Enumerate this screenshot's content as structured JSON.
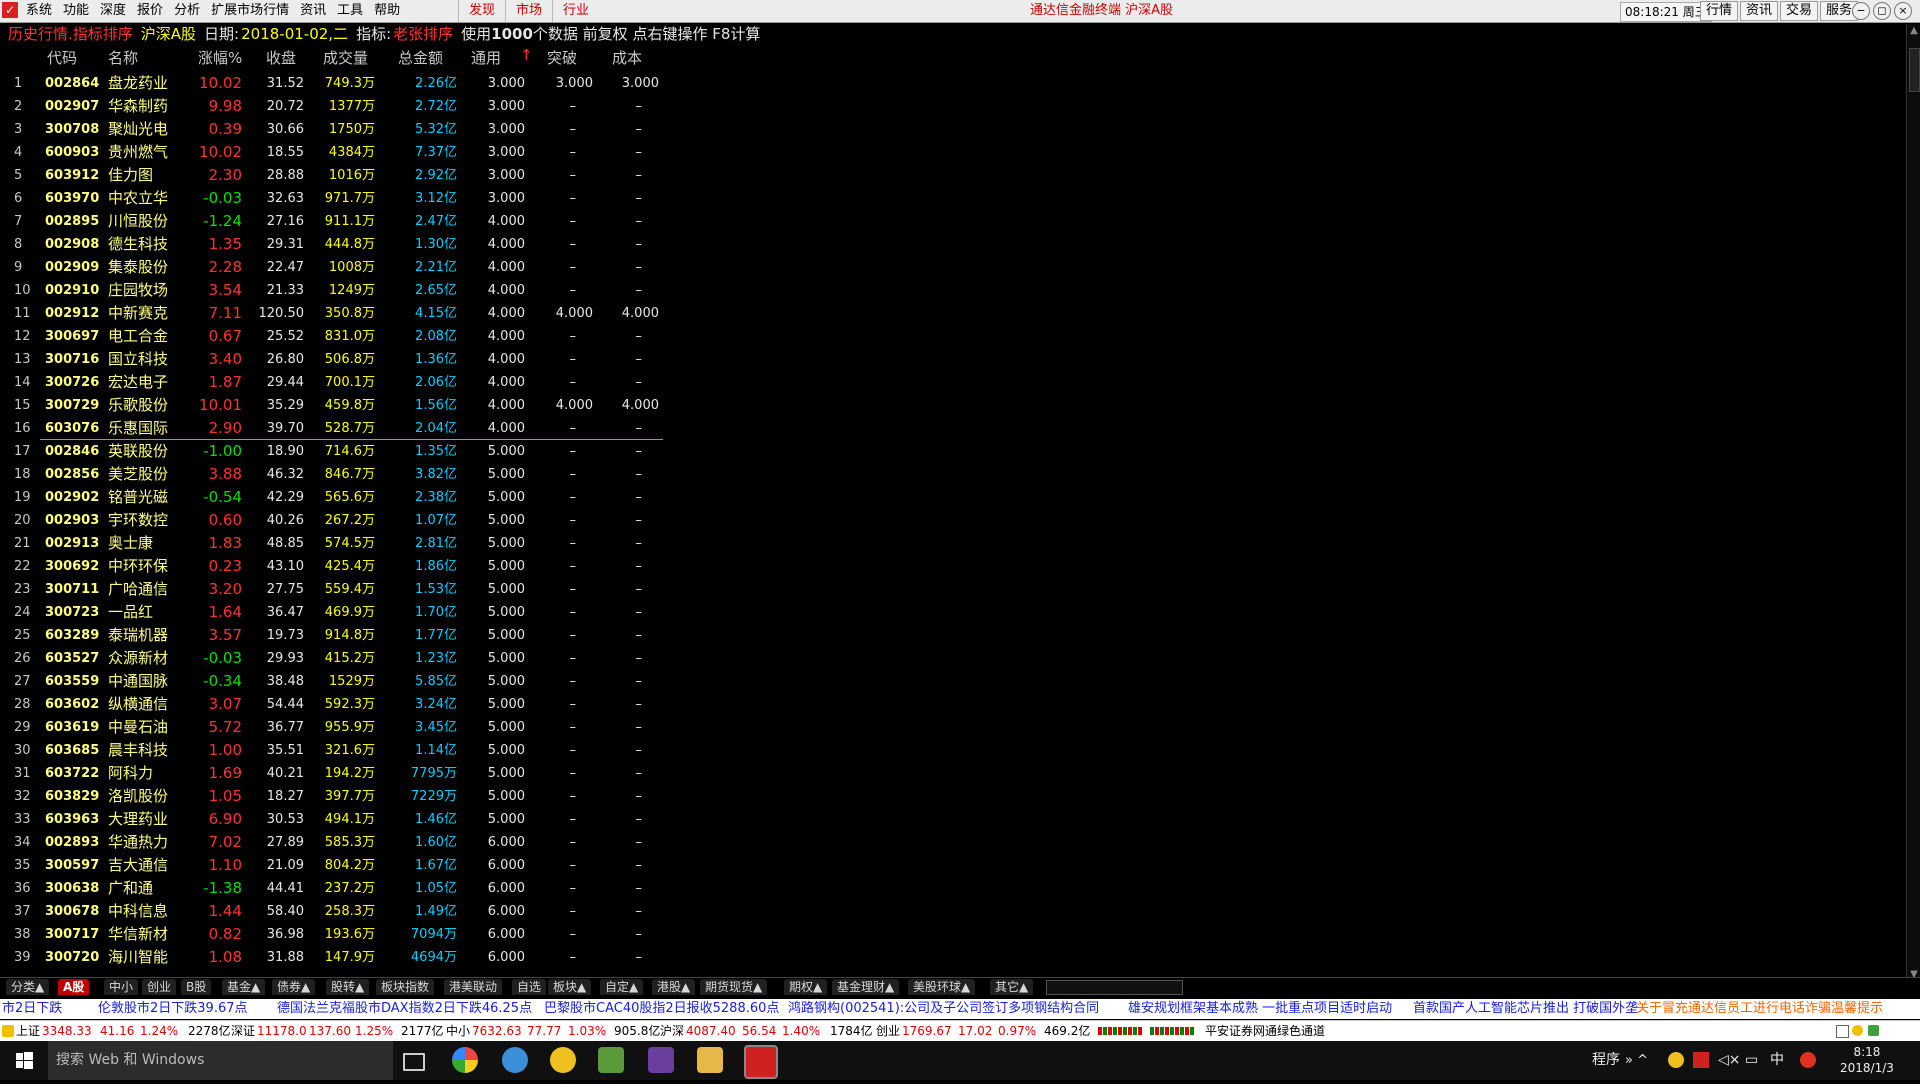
{
  "menubar": {
    "items": [
      "系统",
      "功能",
      "深度",
      "报价",
      "分析",
      "扩展市场行情",
      "资讯",
      "工具",
      "帮助"
    ],
    "highlights": [
      "发现",
      "市场",
      "行业"
    ],
    "app_title": "通达信金融终端  沪深A股",
    "clock": "08:18:21 周三",
    "right_buttons": [
      "行情",
      "资讯",
      "交易",
      "服务"
    ],
    "window_buttons": [
      "−",
      "◻",
      "×"
    ]
  },
  "infobar": {
    "mode": "历史行情.指标排序",
    "market": "沪深A股",
    "date_label": "日期:",
    "date": "2018-01-02,二",
    "indicator_label": "指标:",
    "indicator": "老张排序",
    "note_prefix": "使用",
    "note_count": "1000",
    "note_rest": "个数据 前复权 点右键操作 F8计算"
  },
  "table": {
    "headers": [
      "代码",
      "名称",
      "涨幅%",
      "收盘",
      "成交量",
      "总金额",
      "通用",
      "突破",
      "成本"
    ],
    "sort_indicator": "↑",
    "rows": [
      {
        "n": "1",
        "code": "002864",
        "name": "盘龙药业",
        "chg": "10.02",
        "dir": "up",
        "close": "31.52",
        "vol": "749.3万",
        "amt": "2.26亿",
        "gen": "3.000",
        "brk": "3.000",
        "cost": "3.000"
      },
      {
        "n": "2",
        "code": "002907",
        "name": "华森制药",
        "chg": "9.98",
        "dir": "up",
        "close": "20.72",
        "vol": "1377万",
        "amt": "2.72亿",
        "gen": "3.000",
        "brk": "–",
        "cost": "–"
      },
      {
        "n": "3",
        "code": "300708",
        "name": "聚灿光电",
        "chg": "0.39",
        "dir": "up",
        "close": "30.66",
        "vol": "1750万",
        "amt": "5.32亿",
        "gen": "3.000",
        "brk": "–",
        "cost": "–"
      },
      {
        "n": "4",
        "code": "600903",
        "name": "贵州燃气",
        "chg": "10.02",
        "dir": "up",
        "close": "18.55",
        "vol": "4384万",
        "amt": "7.37亿",
        "gen": "3.000",
        "brk": "–",
        "cost": "–"
      },
      {
        "n": "5",
        "code": "603912",
        "name": "佳力图",
        "chg": "2.30",
        "dir": "up",
        "close": "28.88",
        "vol": "1016万",
        "amt": "2.92亿",
        "gen": "3.000",
        "brk": "–",
        "cost": "–"
      },
      {
        "n": "6",
        "code": "603970",
        "name": "中农立华",
        "chg": "-0.03",
        "dir": "dn",
        "close": "32.63",
        "vol": "971.7万",
        "amt": "3.12亿",
        "gen": "3.000",
        "brk": "–",
        "cost": "–"
      },
      {
        "n": "7",
        "code": "002895",
        "name": "川恒股份",
        "chg": "-1.24",
        "dir": "dn",
        "close": "27.16",
        "vol": "911.1万",
        "amt": "2.47亿",
        "gen": "4.000",
        "brk": "–",
        "cost": "–"
      },
      {
        "n": "8",
        "code": "002908",
        "name": "德生科技",
        "chg": "1.35",
        "dir": "up",
        "close": "29.31",
        "vol": "444.8万",
        "amt": "1.30亿",
        "gen": "4.000",
        "brk": "–",
        "cost": "–"
      },
      {
        "n": "9",
        "code": "002909",
        "name": "集泰股份",
        "chg": "2.28",
        "dir": "up",
        "close": "22.47",
        "vol": "1008万",
        "amt": "2.21亿",
        "gen": "4.000",
        "brk": "–",
        "cost": "–"
      },
      {
        "n": "10",
        "code": "002910",
        "name": "庄园牧场",
        "chg": "3.54",
        "dir": "up",
        "close": "21.33",
        "vol": "1249万",
        "amt": "2.65亿",
        "gen": "4.000",
        "brk": "–",
        "cost": "–"
      },
      {
        "n": "11",
        "code": "002912",
        "name": "中新赛克",
        "chg": "7.11",
        "dir": "up",
        "close": "120.50",
        "vol": "350.8万",
        "amt": "4.15亿",
        "gen": "4.000",
        "brk": "4.000",
        "cost": "4.000"
      },
      {
        "n": "12",
        "code": "300697",
        "name": "电工合金",
        "chg": "0.67",
        "dir": "up",
        "close": "25.52",
        "vol": "831.0万",
        "amt": "2.08亿",
        "gen": "4.000",
        "brk": "–",
        "cost": "–"
      },
      {
        "n": "13",
        "code": "300716",
        "name": "国立科技",
        "chg": "3.40",
        "dir": "up",
        "close": "26.80",
        "vol": "506.8万",
        "amt": "1.36亿",
        "gen": "4.000",
        "brk": "–",
        "cost": "–"
      },
      {
        "n": "14",
        "code": "300726",
        "name": "宏达电子",
        "chg": "1.87",
        "dir": "up",
        "close": "29.44",
        "vol": "700.1万",
        "amt": "2.06亿",
        "gen": "4.000",
        "brk": "–",
        "cost": "–"
      },
      {
        "n": "15",
        "code": "300729",
        "name": "乐歌股份",
        "chg": "10.01",
        "dir": "up",
        "close": "35.29",
        "vol": "459.8万",
        "amt": "1.56亿",
        "gen": "4.000",
        "brk": "4.000",
        "cost": "4.000"
      },
      {
        "n": "16",
        "code": "603076",
        "name": "乐惠国际",
        "chg": "2.90",
        "dir": "up",
        "close": "39.70",
        "vol": "528.7万",
        "amt": "2.04亿",
        "gen": "4.000",
        "brk": "–",
        "cost": "–"
      },
      {
        "n": "17",
        "code": "002846",
        "name": "英联股份",
        "chg": "-1.00",
        "dir": "dn",
        "close": "18.90",
        "vol": "714.6万",
        "amt": "1.35亿",
        "gen": "5.000",
        "brk": "–",
        "cost": "–"
      },
      {
        "n": "18",
        "code": "002856",
        "name": "美芝股份",
        "chg": "3.88",
        "dir": "up",
        "close": "46.32",
        "vol": "846.7万",
        "amt": "3.82亿",
        "gen": "5.000",
        "brk": "–",
        "cost": "–"
      },
      {
        "n": "19",
        "code": "002902",
        "name": "铭普光磁",
        "chg": "-0.54",
        "dir": "dn",
        "close": "42.29",
        "vol": "565.6万",
        "amt": "2.38亿",
        "gen": "5.000",
        "brk": "–",
        "cost": "–"
      },
      {
        "n": "20",
        "code": "002903",
        "name": "宇环数控",
        "chg": "0.60",
        "dir": "up",
        "close": "40.26",
        "vol": "267.2万",
        "amt": "1.07亿",
        "gen": "5.000",
        "brk": "–",
        "cost": "–"
      },
      {
        "n": "21",
        "code": "002913",
        "name": "奥士康",
        "chg": "1.83",
        "dir": "up",
        "close": "48.85",
        "vol": "574.5万",
        "amt": "2.81亿",
        "gen": "5.000",
        "brk": "–",
        "cost": "–"
      },
      {
        "n": "22",
        "code": "300692",
        "name": "中环环保",
        "chg": "0.23",
        "dir": "up",
        "close": "43.10",
        "vol": "425.4万",
        "amt": "1.86亿",
        "gen": "5.000",
        "brk": "–",
        "cost": "–"
      },
      {
        "n": "23",
        "code": "300711",
        "name": "广哈通信",
        "chg": "3.20",
        "dir": "up",
        "close": "27.75",
        "vol": "559.4万",
        "amt": "1.53亿",
        "gen": "5.000",
        "brk": "–",
        "cost": "–"
      },
      {
        "n": "24",
        "code": "300723",
        "name": "一品红",
        "chg": "1.64",
        "dir": "up",
        "close": "36.47",
        "vol": "469.9万",
        "amt": "1.70亿",
        "gen": "5.000",
        "brk": "–",
        "cost": "–"
      },
      {
        "n": "25",
        "code": "603289",
        "name": "泰瑞机器",
        "chg": "3.57",
        "dir": "up",
        "close": "19.73",
        "vol": "914.8万",
        "amt": "1.77亿",
        "gen": "5.000",
        "brk": "–",
        "cost": "–"
      },
      {
        "n": "26",
        "code": "603527",
        "name": "众源新材",
        "chg": "-0.03",
        "dir": "dn",
        "close": "29.93",
        "vol": "415.2万",
        "amt": "1.23亿",
        "gen": "5.000",
        "brk": "–",
        "cost": "–"
      },
      {
        "n": "27",
        "code": "603559",
        "name": "中通国脉",
        "chg": "-0.34",
        "dir": "dn",
        "close": "38.48",
        "vol": "1529万",
        "amt": "5.85亿",
        "gen": "5.000",
        "brk": "–",
        "cost": "–"
      },
      {
        "n": "28",
        "code": "603602",
        "name": "纵横通信",
        "chg": "3.07",
        "dir": "up",
        "close": "54.44",
        "vol": "592.3万",
        "amt": "3.24亿",
        "gen": "5.000",
        "brk": "–",
        "cost": "–"
      },
      {
        "n": "29",
        "code": "603619",
        "name": "中曼石油",
        "chg": "5.72",
        "dir": "up",
        "close": "36.77",
        "vol": "955.9万",
        "amt": "3.45亿",
        "gen": "5.000",
        "brk": "–",
        "cost": "–"
      },
      {
        "n": "30",
        "code": "603685",
        "name": "晨丰科技",
        "chg": "1.00",
        "dir": "up",
        "close": "35.51",
        "vol": "321.6万",
        "amt": "1.14亿",
        "gen": "5.000",
        "brk": "–",
        "cost": "–"
      },
      {
        "n": "31",
        "code": "603722",
        "name": "阿科力",
        "chg": "1.69",
        "dir": "up",
        "close": "40.21",
        "vol": "194.2万",
        "amt": "7795万",
        "gen": "5.000",
        "brk": "–",
        "cost": "–"
      },
      {
        "n": "32",
        "code": "603829",
        "name": "洛凯股份",
        "chg": "1.05",
        "dir": "up",
        "close": "18.27",
        "vol": "397.7万",
        "amt": "7229万",
        "gen": "5.000",
        "brk": "–",
        "cost": "–"
      },
      {
        "n": "33",
        "code": "603963",
        "name": "大理药业",
        "chg": "6.90",
        "dir": "up",
        "close": "30.53",
        "vol": "494.1万",
        "amt": "1.46亿",
        "gen": "5.000",
        "brk": "–",
        "cost": "–"
      },
      {
        "n": "34",
        "code": "002893",
        "name": "华通热力",
        "chg": "7.02",
        "dir": "up",
        "close": "27.89",
        "vol": "585.3万",
        "amt": "1.60亿",
        "gen": "6.000",
        "brk": "–",
        "cost": "–"
      },
      {
        "n": "35",
        "code": "300597",
        "name": "吉大通信",
        "chg": "1.10",
        "dir": "up",
        "close": "21.09",
        "vol": "804.2万",
        "amt": "1.67亿",
        "gen": "6.000",
        "brk": "–",
        "cost": "–"
      },
      {
        "n": "36",
        "code": "300638",
        "name": "广和通",
        "chg": "-1.38",
        "dir": "dn",
        "close": "44.41",
        "vol": "237.2万",
        "amt": "1.05亿",
        "gen": "6.000",
        "brk": "–",
        "cost": "–"
      },
      {
        "n": "37",
        "code": "300678",
        "name": "中科信息",
        "chg": "1.44",
        "dir": "up",
        "close": "58.40",
        "vol": "258.3万",
        "amt": "1.49亿",
        "gen": "6.000",
        "brk": "–",
        "cost": "–"
      },
      {
        "n": "38",
        "code": "300717",
        "name": "华信新材",
        "chg": "0.82",
        "dir": "up",
        "close": "36.98",
        "vol": "193.6万",
        "amt": "7094万",
        "gen": "6.000",
        "brk": "–",
        "cost": "–"
      },
      {
        "n": "39",
        "code": "300720",
        "name": "海川智能",
        "chg": "1.08",
        "dir": "up",
        "close": "31.88",
        "vol": "147.9万",
        "amt": "4694万",
        "gen": "6.000",
        "brk": "–",
        "cost": "–"
      }
    ]
  },
  "tabs": [
    {
      "label": "分类▲",
      "active": false
    },
    {
      "label": "A股",
      "active": true
    },
    {
      "label": "中小",
      "active": false
    },
    {
      "label": "创业",
      "active": false
    },
    {
      "label": "B股",
      "active": false
    },
    {
      "label": "基金▲",
      "active": false
    },
    {
      "label": "债券▲",
      "active": false
    },
    {
      "label": "股转▲",
      "active": false
    },
    {
      "label": "板块指数",
      "active": false
    },
    {
      "label": "港美联动",
      "active": false
    },
    {
      "label": "自选",
      "active": false
    },
    {
      "label": "板块▲",
      "active": false
    },
    {
      "label": "自定▲",
      "active": false
    },
    {
      "label": "港股▲",
      "active": false
    },
    {
      "label": "期货现货▲",
      "active": false
    },
    {
      "label": "期权▲",
      "active": false
    },
    {
      "label": "基金理财▲",
      "active": false
    },
    {
      "label": "美股环球▲",
      "active": false
    },
    {
      "label": "其它▲",
      "active": false
    }
  ],
  "ticker": [
    "市2日下跌",
    "伦敦股市2日下跌39.67点",
    "德国法兰克福股市DAX指数2日下跌46.25点",
    "巴黎股市CAC40股指2日报收5288.60点",
    "鸿路钢构(002541):公司及子公司签订多项钢结构合同",
    "雄安规划框架基本成熟 一批重点项目适时启动",
    "首款国产人工智能芯片推出 打破国外垄",
    "关于冒充通达信员工进行电话诈骗温馨提示"
  ],
  "indexbar": {
    "sh_label": "上证",
    "sh_val": "3348.33",
    "sh_chg": "41.16",
    "sh_pct": "1.24%",
    "sh_amt": "2278亿",
    "sz_label": "深证",
    "sz_val": "11178.0",
    "sz_chg": "137.60",
    "sz_pct": "1.25%",
    "sz_amt": "2177亿",
    "zx_label": "中小",
    "zx_val": "7632.63",
    "zx_chg": "77.77",
    "zx_pct": "1.03%",
    "zx_amt": "905.8亿",
    "hs_label": "沪深",
    "hs_val": "4087.40",
    "hs_chg": "56.54",
    "hs_pct": "1.40%",
    "hs_amt": "1784亿",
    "cy_label": "创业",
    "cy_val": "1769.67",
    "cy_chg": "17.02",
    "cy_pct": "0.97%",
    "cy_amt": "469.2亿",
    "broker": "平安证券网通绿色通道"
  },
  "taskbar": {
    "search_placeholder": "搜索 Web 和 Windows",
    "tray_text": "程序",
    "time": "8:18",
    "date": "2018/1/3"
  },
  "colors": {
    "up": "#ff3232",
    "down": "#00e000",
    "code": "#ffff80",
    "amount": "#00d0ff",
    "volume": "#ffff00",
    "active_tab": "#c00000"
  }
}
